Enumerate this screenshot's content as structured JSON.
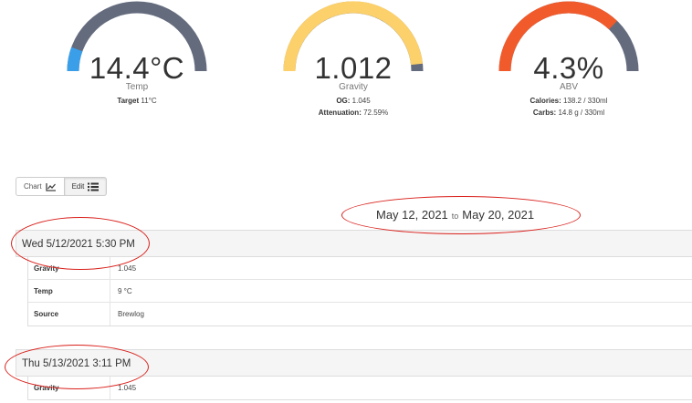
{
  "gauges": {
    "temp": {
      "value": "14.4°C",
      "label": "Temp",
      "target_label": "Target",
      "target_value": "11°C",
      "fill_fraction": 0.14,
      "colors": {
        "fill": "#3a9ee8",
        "track": "#636b7d"
      }
    },
    "gravity": {
      "value": "1.012",
      "label": "Gravity",
      "og_label": "OG:",
      "og_value": "1.045",
      "attenuation_label": "Attenuation:",
      "attenuation_value": "72.59%",
      "fill_fraction": 0.93,
      "colors": {
        "fill": "#fcd06a",
        "track": "#636b7d"
      }
    },
    "abv": {
      "value": "4.3%",
      "label": "ABV",
      "calories_label": "Calories:",
      "calories_value": "138.2 / 330ml",
      "carbs_label": "Carbs:",
      "carbs_value": "14.8 g / 330ml",
      "fill_fraction": 0.72,
      "colors": {
        "fill": "#f15a2b",
        "track": "#636b7d"
      }
    }
  },
  "view_toggle": {
    "chart_label": "Chart",
    "chart_icon": "line-chart-icon",
    "edit_label": "Edit",
    "edit_icon": "list-icon",
    "active": "edit"
  },
  "date_range": {
    "start": "May 12, 2021",
    "separator": "to",
    "end": "May 20, 2021"
  },
  "entries": [
    {
      "header": "Wed 5/12/2021 5:30 PM",
      "rows": [
        {
          "key": "Gravity",
          "value": "1.045"
        },
        {
          "key": "Temp",
          "value": "9 °C"
        },
        {
          "key": "Source",
          "value": "Brewlog"
        }
      ]
    },
    {
      "header": "Thu 5/13/2021 3:11 PM",
      "rows": [
        {
          "key": "Gravity",
          "value": "1.045"
        }
      ]
    }
  ],
  "annotation_color": "#d9201b"
}
